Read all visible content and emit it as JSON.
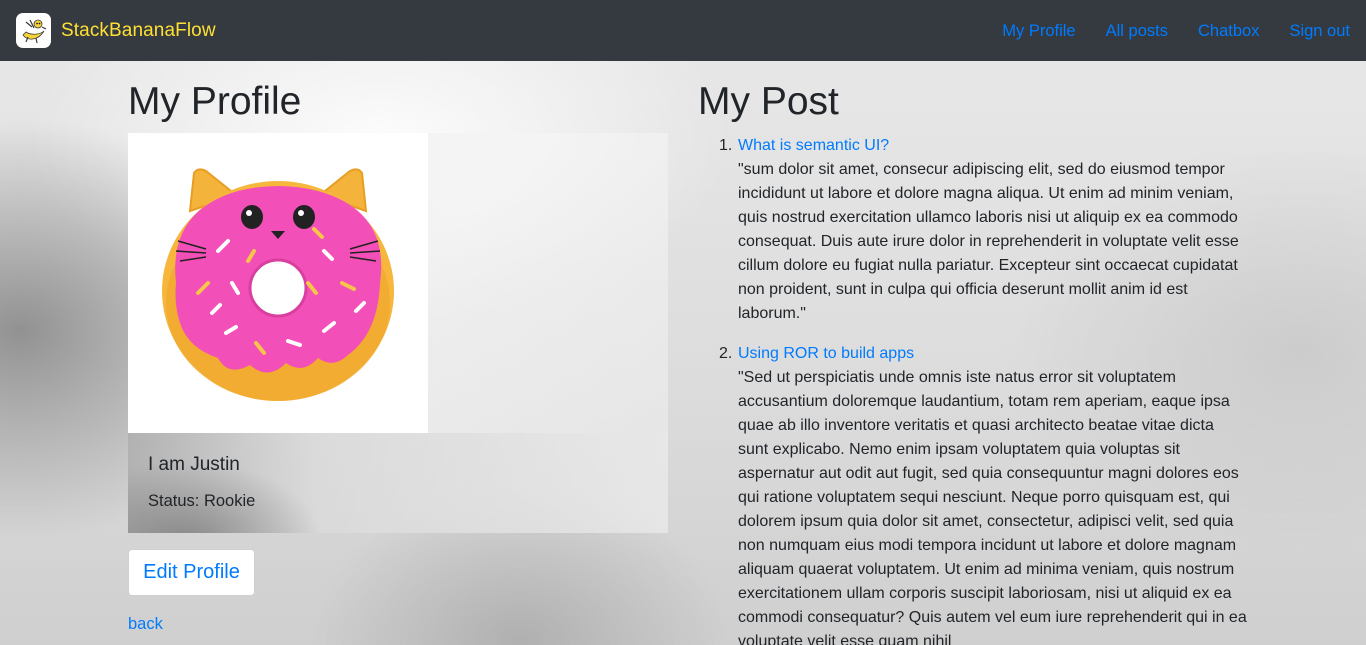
{
  "navbar": {
    "brand": "StackBananaFlow",
    "logo_icon": "banana-mascot-icon",
    "links": [
      "My Profile",
      "All posts",
      "Chatbox",
      "Sign out"
    ],
    "link_color": "#007bff",
    "brand_color": "#ffe033",
    "background": "#343a40"
  },
  "profile": {
    "heading": "My Profile",
    "avatar_icon": "pink-cat-donut-image",
    "name": "I am Justin",
    "status": "Status: Rookie",
    "edit_button": "Edit Profile",
    "back_link": "back"
  },
  "posts": {
    "heading": "My Post",
    "items": [
      {
        "number": "1.",
        "title": "What is semantic UI?",
        "body": "\"sum dolor sit amet, consecur adipiscing elit, sed do eiusmod tempor incididunt ut labore et dolore magna aliqua. Ut enim ad minim veniam, quis nostrud exercitation ullamco laboris nisi ut aliquip ex ea commodo consequat. Duis aute irure dolor in reprehenderit in voluptate velit esse cillum dolore eu fugiat nulla pariatur. Excepteur sint occaecat cupidatat non proident, sunt in culpa qui officia deserunt mollit anim id est laborum.\""
      },
      {
        "number": "2.",
        "title": "Using ROR to build apps",
        "body": "\"Sed ut perspiciatis unde omnis iste natus error sit voluptatem accusantium doloremque laudantium, totam rem aperiam, eaque ipsa quae ab illo inventore veritatis et quasi architecto beatae vitae dicta sunt explicabo. Nemo enim ipsam voluptatem quia voluptas sit aspernatur aut odit aut fugit, sed quia consequuntur magni dolores eos qui ratione voluptatem sequi nesciunt. Neque porro quisquam est, qui dolorem ipsum quia dolor sit amet, consectetur, adipisci velit, sed quia non numquam eius modi tempora incidunt ut labore et dolore magnam aliquam quaerat voluptatem. Ut enim ad minima veniam, quis nostrum exercitationem ullam corporis suscipit laboriosam, nisi ut aliquid ex ea commodi consequatur? Quis autem vel eum iure reprehenderit qui in ea voluptate velit esse quam nihil"
      }
    ]
  }
}
